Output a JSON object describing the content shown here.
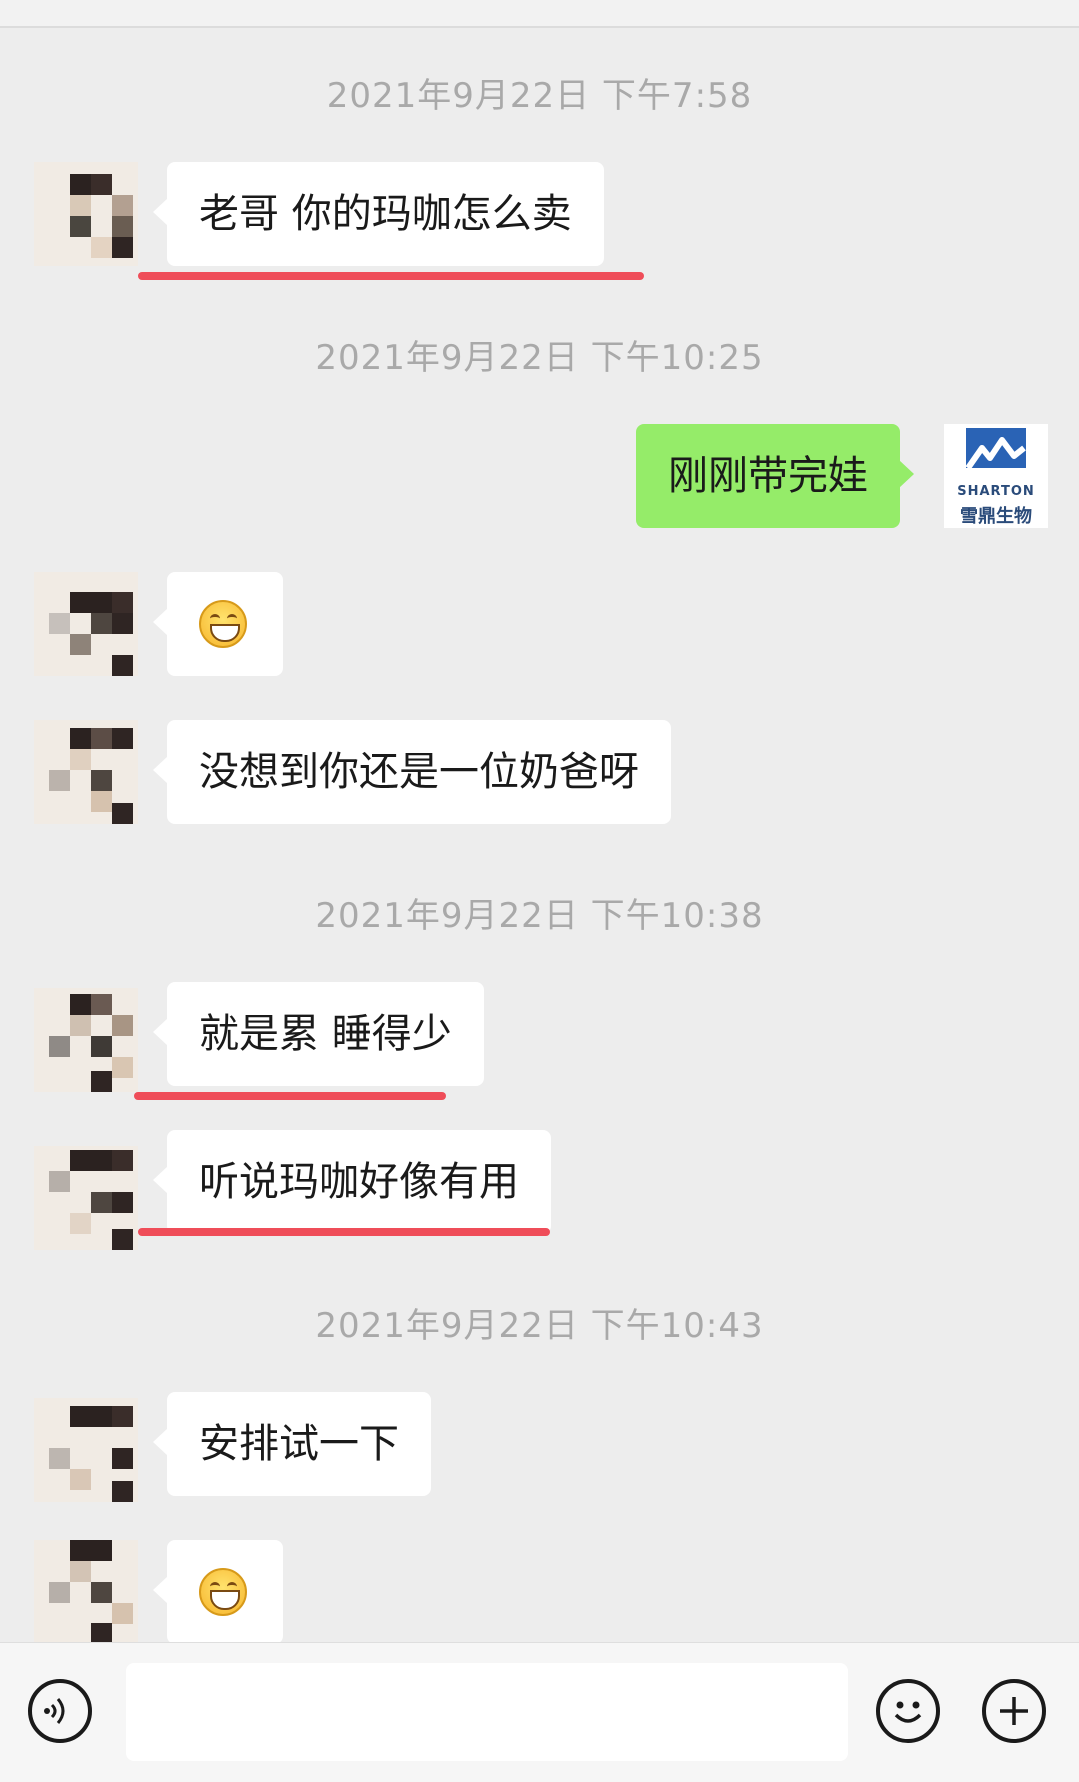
{
  "timestamps": [
    "2021年9月22日 下午7:58",
    "2021年9月22日 下午10:25",
    "2021年9月22日 下午10:38",
    "2021年9月22日 下午10:43"
  ],
  "messages": [
    {
      "side": "left",
      "text": "老哥 你的玛咖怎么卖"
    },
    {
      "side": "right",
      "text": "刚刚带完娃"
    },
    {
      "side": "left",
      "emoji": "grinning-face"
    },
    {
      "side": "left",
      "text": "没想到你还是一位奶爸呀"
    },
    {
      "side": "left",
      "text": "就是累 睡得少"
    },
    {
      "side": "left",
      "text": "听说玛咖好像有用"
    },
    {
      "side": "left",
      "text": "安排试一下"
    },
    {
      "side": "left",
      "emoji": "grinning-face"
    }
  ],
  "brand_avatar": {
    "en": "SHARTON",
    "cn": "雪鼎生物",
    "color": "#2a63b5"
  },
  "input": {
    "value": "",
    "placeholder": ""
  },
  "icons": {
    "voice": "voice-icon",
    "emoji": "emoji-icon",
    "plus": "plus-icon"
  },
  "colors": {
    "background": "#ededed",
    "self_bubble": "#95ec69",
    "other_bubble": "#ffffff",
    "highlight_underline": "#ef4d59"
  }
}
